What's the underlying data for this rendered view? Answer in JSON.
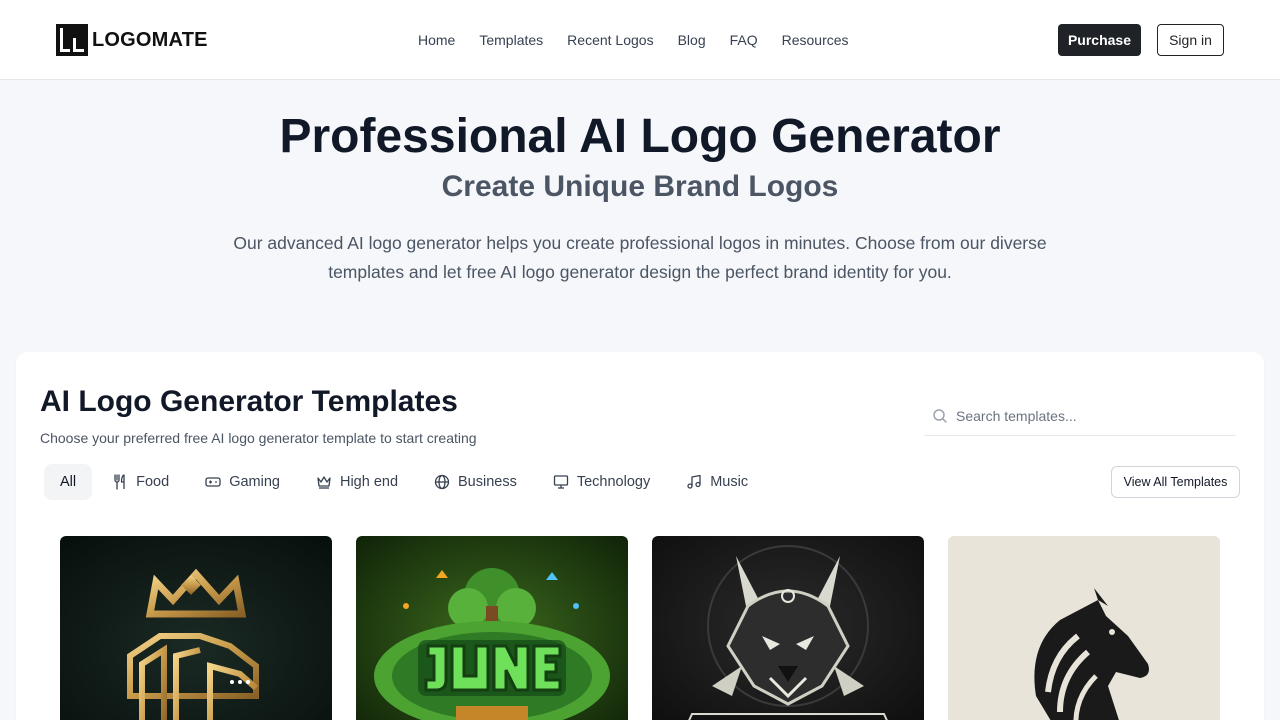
{
  "header": {
    "logo_text": "LOGOMATE",
    "nav": [
      {
        "label": "Home"
      },
      {
        "label": "Templates"
      },
      {
        "label": "Recent Logos"
      },
      {
        "label": "Blog"
      },
      {
        "label": "FAQ"
      },
      {
        "label": "Resources"
      }
    ],
    "purchase_label": "Purchase",
    "signin_label": "Sign in"
  },
  "hero": {
    "title": "Professional AI Logo Generator",
    "subtitle": "Create Unique Brand Logos",
    "description": "Our advanced AI logo generator helps you create professional logos in minutes. Choose from our diverse templates and let free AI logo generator design the perfect brand identity for you."
  },
  "templates": {
    "title": "AI Logo Generator Templates",
    "description": "Choose your preferred free AI logo generator template to start creating",
    "search_placeholder": "Search templates...",
    "view_all_label": "View All Templates",
    "categories": [
      {
        "label": "All",
        "icon": "none",
        "active": true
      },
      {
        "label": "Food",
        "icon": "utensils-icon",
        "active": false
      },
      {
        "label": "Gaming",
        "icon": "gamepad-icon",
        "active": false
      },
      {
        "label": "High end",
        "icon": "crown-icon",
        "active": false
      },
      {
        "label": "Business",
        "icon": "globe-icon",
        "active": false
      },
      {
        "label": "Technology",
        "icon": "monitor-icon",
        "active": false
      },
      {
        "label": "Music",
        "icon": "music-note-icon",
        "active": false
      }
    ],
    "cards": [
      {
        "theme": "golden-lion-crown",
        "bg": "#0f1c18"
      },
      {
        "theme": "jungle-jump-game",
        "bg": "#1f3a12"
      },
      {
        "theme": "wolf-emblem",
        "bg": "#1a1a1a"
      },
      {
        "theme": "black-horse-head",
        "bg": "#e8e4da"
      }
    ]
  },
  "colors": {
    "primary_dark": "#1f2328",
    "page_bg": "#f5f7fa",
    "text_muted": "#4b5563"
  }
}
